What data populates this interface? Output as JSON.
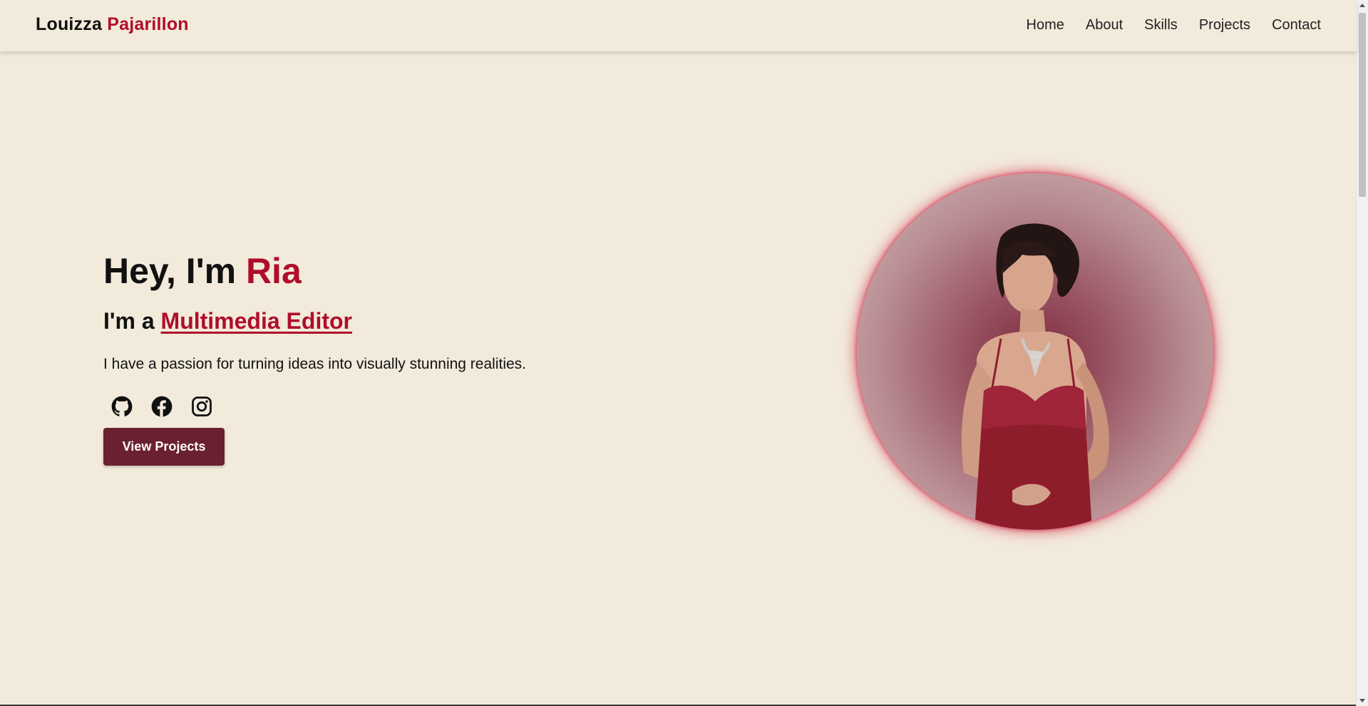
{
  "header": {
    "logo_first": "Louizza",
    "logo_last": "Pajarillon",
    "nav": [
      "Home",
      "About",
      "Skills",
      "Projects",
      "Contact"
    ]
  },
  "hero": {
    "greeting": "Hey, I'm",
    "name": "Ria",
    "role_prefix": "I'm a",
    "role": "Multimedia Editor",
    "description": "I have a passion for turning ideas into visually stunning realities.",
    "socials": [
      "github-icon",
      "facebook-icon",
      "instagram-icon"
    ],
    "cta_label": "View Projects"
  },
  "colors": {
    "background": "#f2eadb",
    "accent": "#b00d2b",
    "button": "#6b2030"
  }
}
